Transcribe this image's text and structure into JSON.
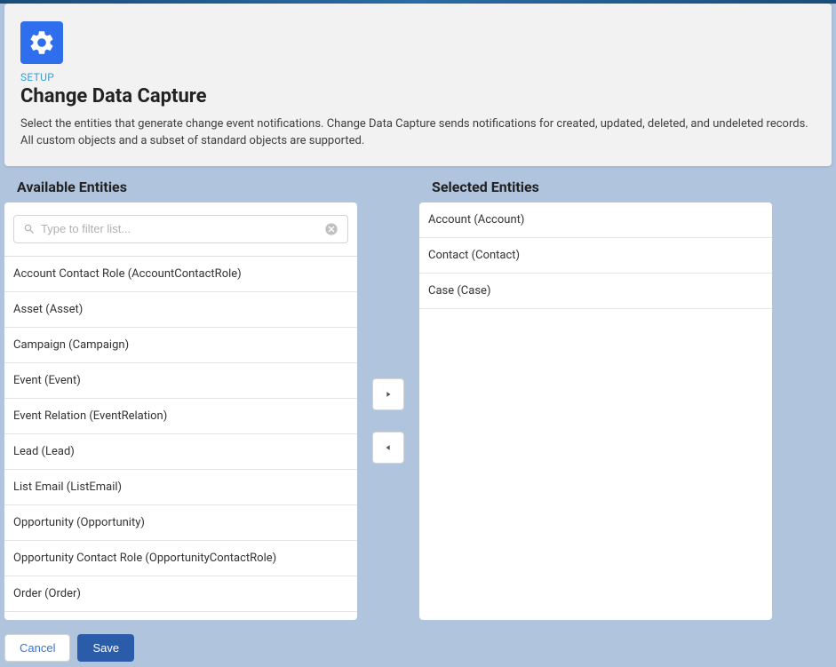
{
  "header": {
    "breadcrumb": "SETUP",
    "title": "Change Data Capture",
    "description": "Select the entities that generate change event notifications. Change Data Capture sends notifications for created, updated, deleted, and undeleted records. All custom objects and a subset of standard objects are supported."
  },
  "available": {
    "heading": "Available Entities",
    "search_placeholder": "Type to filter list...",
    "items": [
      "Account Contact Role (AccountContactRole)",
      "Asset (Asset)",
      "Campaign (Campaign)",
      "Event (Event)",
      "Event Relation (EventRelation)",
      "Lead (Lead)",
      "List Email (ListEmail)",
      "Opportunity (Opportunity)",
      "Opportunity Contact Role (OpportunityContactRole)",
      "Order (Order)"
    ]
  },
  "selected": {
    "heading": "Selected Entities",
    "items": [
      "Account (Account)",
      "Contact (Contact)",
      "Case (Case)"
    ]
  },
  "buttons": {
    "cancel": "Cancel",
    "save": "Save"
  }
}
